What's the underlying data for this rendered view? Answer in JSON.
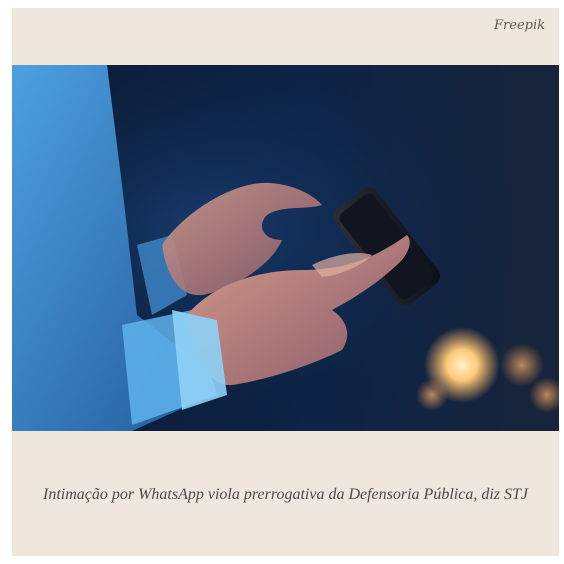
{
  "credit": "Freepik",
  "photo": {
    "description_icon": "photo-hands-phone-icon",
    "colors": {
      "background_dark": "#081429",
      "background_mid": "#1b3a6a",
      "sleeve": "#3b86c8",
      "skin": "#c88a7a",
      "bokeh": "#ffcf85"
    }
  },
  "caption": "Intimação por WhatsApp viola prerrogativa da Defensoria Pública, diz STJ"
}
